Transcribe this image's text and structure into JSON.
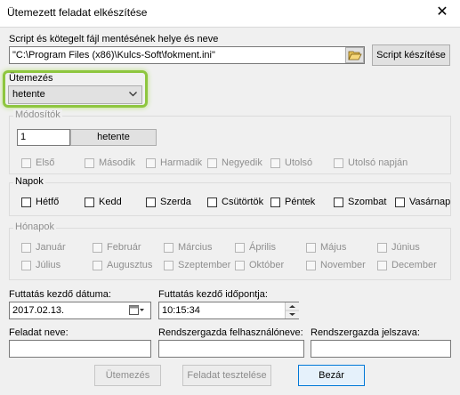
{
  "window": {
    "title": "Ütemezett feladat elkészítése",
    "close_glyph": "✕"
  },
  "script": {
    "label": "Script és kötegelt fájl mentésének helye és neve",
    "path": "\"C:\\Program Files (x86)\\Kulcs-Soft\\fokment.ini\"",
    "create_button": "Script készítése"
  },
  "schedule": {
    "label": "Ütemezés",
    "value": "hetente"
  },
  "modifiers": {
    "title": "Módosítók",
    "interval_value": "1",
    "interval_unit": "hetente",
    "options": [
      "Első",
      "Második",
      "Harmadik",
      "Negyedik",
      "Utolsó",
      "Utolsó napján"
    ]
  },
  "days": {
    "title": "Napok",
    "items": [
      "Hétfő",
      "Kedd",
      "Szerda",
      "Csütörtök",
      "Péntek",
      "Szombat",
      "Vasárnap"
    ]
  },
  "months": {
    "title": "Hónapok",
    "items": [
      "Január",
      "Február",
      "Március",
      "Április",
      "Május",
      "Június",
      "Július",
      "Augusztus",
      "Szeptember",
      "Október",
      "November",
      "December"
    ]
  },
  "start_date": {
    "label": "Futtatás kezdő dátuma:",
    "value": "2017.02.13."
  },
  "start_time": {
    "label": "Futtatás kezdő időpontja:",
    "value": "10:15:34"
  },
  "task_name": {
    "label": "Feladat neve:",
    "value": ""
  },
  "admin_user": {
    "label": "Rendszergazda felhasználóneve:",
    "value": ""
  },
  "admin_password": {
    "label": "Rendszergazda jelszava:",
    "value": ""
  },
  "buttons": {
    "schedule": "Ütemezés",
    "test": "Feladat tesztelése",
    "close": "Bezár"
  },
  "colors": {
    "highlight": "#8ec63f",
    "accent": "#0078d7"
  },
  "icons": {
    "folder": "folder-open-icon",
    "calendar": "calendar-icon",
    "dropdown": "chevron-down-icon"
  }
}
